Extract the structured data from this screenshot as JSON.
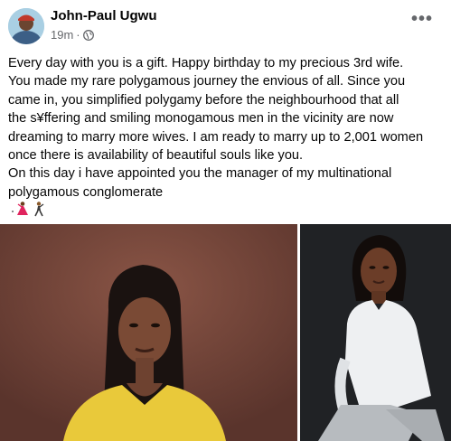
{
  "post": {
    "author": "John-Paul Ugwu",
    "time": "19m",
    "separator": "·",
    "privacy_icon": "globe-icon",
    "more_icon": "more-options-icon",
    "more_label": "•••",
    "lines": [
      "Every day with you is a gift. Happy birthday to my precious 3rd wife.",
      "You made my rare polygamous journey the envious of all.  Since you",
      "came in, you simplified polygamy before the neighbourhood that all",
      "the s¥ffering and smiling monogamous men in the vicinity are now",
      "dreaming to marry more wives. I am ready to marry up to 2,001 women",
      "once there is availability of beautiful souls like you.",
      "On this day i have appointed you the manager of my multinational",
      "polygamous conglomerate"
    ],
    "emoji_icons": [
      "dancing-woman-icon",
      "dancing-man-icon"
    ]
  },
  "photos": [
    {
      "description_icon": "woman-yellow-top-photo"
    },
    {
      "description_icon": "woman-white-shirt-seated-photo"
    }
  ],
  "colors": {
    "text": "#050505",
    "secondary": "#65676b",
    "photo_left_bg": "#6b3f35",
    "photo_right_bg": "#1c1e21"
  }
}
